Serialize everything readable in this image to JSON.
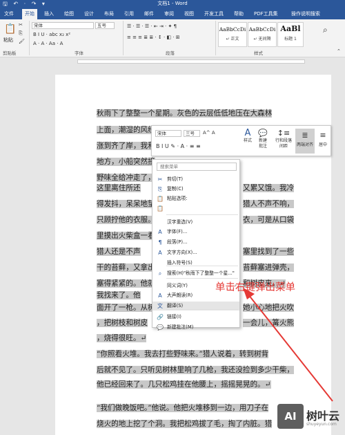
{
  "titlebar": {
    "quick_access": "🖫 ↶ · ↷ ▾",
    "title": "文档1 - Word"
  },
  "tabs": [
    "文件",
    "开始",
    "插入",
    "绘图",
    "设计",
    "布局",
    "引用",
    "邮件",
    "审阅",
    "视图",
    "开发工具",
    "帮助",
    "PDF工具集",
    "操作说明搜索"
  ],
  "ribbon": {
    "paste": "粘贴",
    "font_name": "宋体",
    "font_size": "五号",
    "font_row": "B I U · abc x₂ x²",
    "font_row2": "A · A · Aa · A",
    "para_row1": "☰ · ☰ · ☰ · ⇤ ⇥ · ✦ ¶",
    "para_row2": "≡ ≡ ≡ ≣ ≣ · ↕ · ◧ · ⊞",
    "groups": {
      "clipboard": "剪贴板",
      "font": "字体",
      "paragraph": "段落",
      "styles": "样式"
    },
    "styles": [
      {
        "preview": "AaBbCcDi",
        "name": "↵ 正文"
      },
      {
        "preview": "AaBbCcDi",
        "name": "↵ 无间隔"
      },
      {
        "preview": "AaBl",
        "name": "标题 1"
      }
    ],
    "find_icon": "⌕",
    "expand": "⌃"
  },
  "document": {
    "lines": [
      "    秋雨下了整整一个星期。灰色的云层低低地压在大森林",
      "上面，潮湿的风经",
      "涨到齐了岸，我和",
      "地方，小船突然撞",
      "野味全给冲走了，",
      "    这里离住所还",
      "得发抖，呆呆地望",
      "只顾拧他的衣服。",
      "里摸出火柴盒一看",
      "    猎人还是不声",
      "干的苔藓，又拿出",
      "塞得紧紧的。他就",
      "    我找来了。他",
      "面开了一枪。从树",
      "，把树枝和树皮",
      "，烧得很旺。↵",
      "    “你照看火堆。我去打些野味来。”猎人说着，转到树背",
      "后就不见了。只听见树林里响了几枪，我还没捡到多少干柴，",
      "他已经回来了。几只松鸡挂在他腰上，摇摇晃晃的。↵",
      "",
      "    “我们做晚饭吧。”他说。他把火堆移到一边，用刀子在",
      "烧火的地上挖了个洞。我把松鸡拔了毛，掏了内脏。猎"
    ],
    "right_fragments": [
      {
        "row": 5,
        "text": "又累又饿。我冷"
      },
      {
        "row": 6,
        "text": "猎人不声不响，"
      },
      {
        "row": 7,
        "text": "衣，可是从口袋"
      },
      {
        "row": 9,
        "text": "塞里找到了一些"
      },
      {
        "row": 10,
        "text": "苔藓塞进弹壳，"
      },
      {
        "row": 11,
        "text": "和树皮来。↵"
      },
      {
        "row": 13,
        "text": "她小心地把火吹"
      },
      {
        "row": 14,
        "text": "一会儿，篝火熊"
      }
    ]
  },
  "mini_toolbar": {
    "font": "宋体",
    "size": "三号",
    "grow": "A^ A",
    "format_row": "B  I  U  ✎ · A · ≡ ≡",
    "styles_btn": "样式",
    "new_comment": "新建\n批注",
    "line_spacing": "行和段落\n间距",
    "justify": "两端对齐",
    "center": "居中"
  },
  "context_menu": {
    "search_placeholder": "搜索菜单",
    "items": [
      {
        "icon": "✂",
        "label": "剪切(T)"
      },
      {
        "icon": "⎘",
        "label": "复制(C)"
      },
      {
        "icon": "📋",
        "label": "粘贴选项:"
      },
      {
        "icon": "📋",
        "label": ""
      },
      {
        "icon": "",
        "label": "汉字重选(V)"
      },
      {
        "icon": "A",
        "label": "字体(F)..."
      },
      {
        "icon": "¶",
        "label": "段落(P)..."
      },
      {
        "icon": "A",
        "label": "文字方向(X)..."
      },
      {
        "icon": "",
        "label": "插入符号(S)"
      },
      {
        "icon": "⌕",
        "label": "搜索(H)\"秋雨下了整整一个星...\""
      },
      {
        "icon": "",
        "label": "同义词(Y)",
        "submenu": "›"
      },
      {
        "icon": "A",
        "label": "大声朗读(R)"
      },
      {
        "icon": "文",
        "label": "翻译(S)"
      },
      {
        "icon": "🔗",
        "label": "链接(I)"
      },
      {
        "icon": "💬",
        "label": "新建批注(M)"
      }
    ]
  },
  "annotation": {
    "text": "单击右键弹出菜单",
    "color": "#e53935"
  },
  "watermark": {
    "logo": "AI",
    "name": "树叶云",
    "url": "shuyeyun.com"
  },
  "colors": {
    "accent": "#2b579a",
    "selection": "#c8c8c8"
  }
}
